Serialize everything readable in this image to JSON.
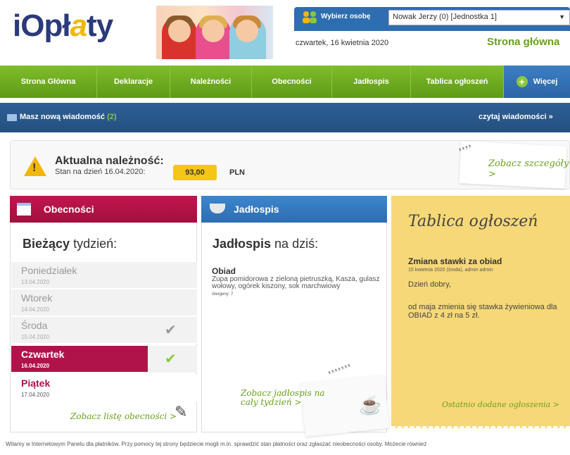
{
  "header": {
    "logo_text": "iOpł",
    "logo_accent": "a",
    "logo_rest": "ty",
    "person_label": "Wybierz osobę",
    "person_selected": "Nowak Jerzy (0) [Jednostka 1]",
    "date": "czwartek, 16 kwietnia 2020",
    "page_title": "Strona główna"
  },
  "nav": {
    "items": [
      "Strona Główna",
      "Deklaracje",
      "Należności",
      "Obecności",
      "Jadłospis",
      "Tablica ogłoszeń"
    ],
    "more": "Więcej"
  },
  "messages": {
    "text": "Masz nową wiadomość",
    "count": "(2)",
    "read_link": "czytaj wiadomości »"
  },
  "dues": {
    "title": "Aktualna należność:",
    "subtitle": "Stan na dzień 16.04.2020:",
    "amount": "93,00",
    "currency": "PLN",
    "details_link": "Zobacz szczegóły >"
  },
  "attendance": {
    "title": "Obecności",
    "week_bold": "Bieżący",
    "week_rest": "tydzień:",
    "days": [
      {
        "name": "Poniedziałek",
        "date": "13.04.2020"
      },
      {
        "name": "Wtorek",
        "date": "14.04.2020"
      },
      {
        "name": "Środa",
        "date": "15.04.2020"
      },
      {
        "name": "Czwartek",
        "date": "16.04.2020"
      },
      {
        "name": "Piątek",
        "date": "17.04.2020"
      }
    ],
    "list_link": "Zobacz listę obecności >"
  },
  "menu": {
    "title": "Jadłospis",
    "today_bold": "Jadłospis",
    "today_rest": "na dziś:",
    "meal_name": "Obiad",
    "meal_desc": "Zupa pomidorowa z zieloną pietruszką, Kasza, gulasz wołowy, ogórek kiszony, sok marchwiowy",
    "allergens": "Alergeny: 7",
    "week_link_1": "Zobacz jadłospis na",
    "week_link_2": "cały tydzień >"
  },
  "board": {
    "title": "Tablica ogłoszeń",
    "item_title": "Zmiana stawki za obiad",
    "item_meta": "15 kwietnia 2020 (środa), admin admin",
    "item_body_1": "Dzień dobry,",
    "item_body_2": "od maja zmienia się stawka żywieniowa dla OBIAD z 4 zł na 5 zł.",
    "latest_link": "Ostatnio dodane ogłoszenia >"
  },
  "footer": {
    "text": "Witamy w Internetowym Panelu dla płatników. Przy pomocy tej strony będziecie mogli m.in. sprawdzić stan płatności oraz zgłaszać nieobecności osoby. Możecie również"
  },
  "colors": {
    "nav_green": "#6aa01e",
    "message_blue": "#23507f",
    "attendance_red": "#b0134a",
    "menu_blue": "#2d6db0",
    "board_yellow": "#f7d878",
    "amount_yellow": "#f5c518"
  }
}
